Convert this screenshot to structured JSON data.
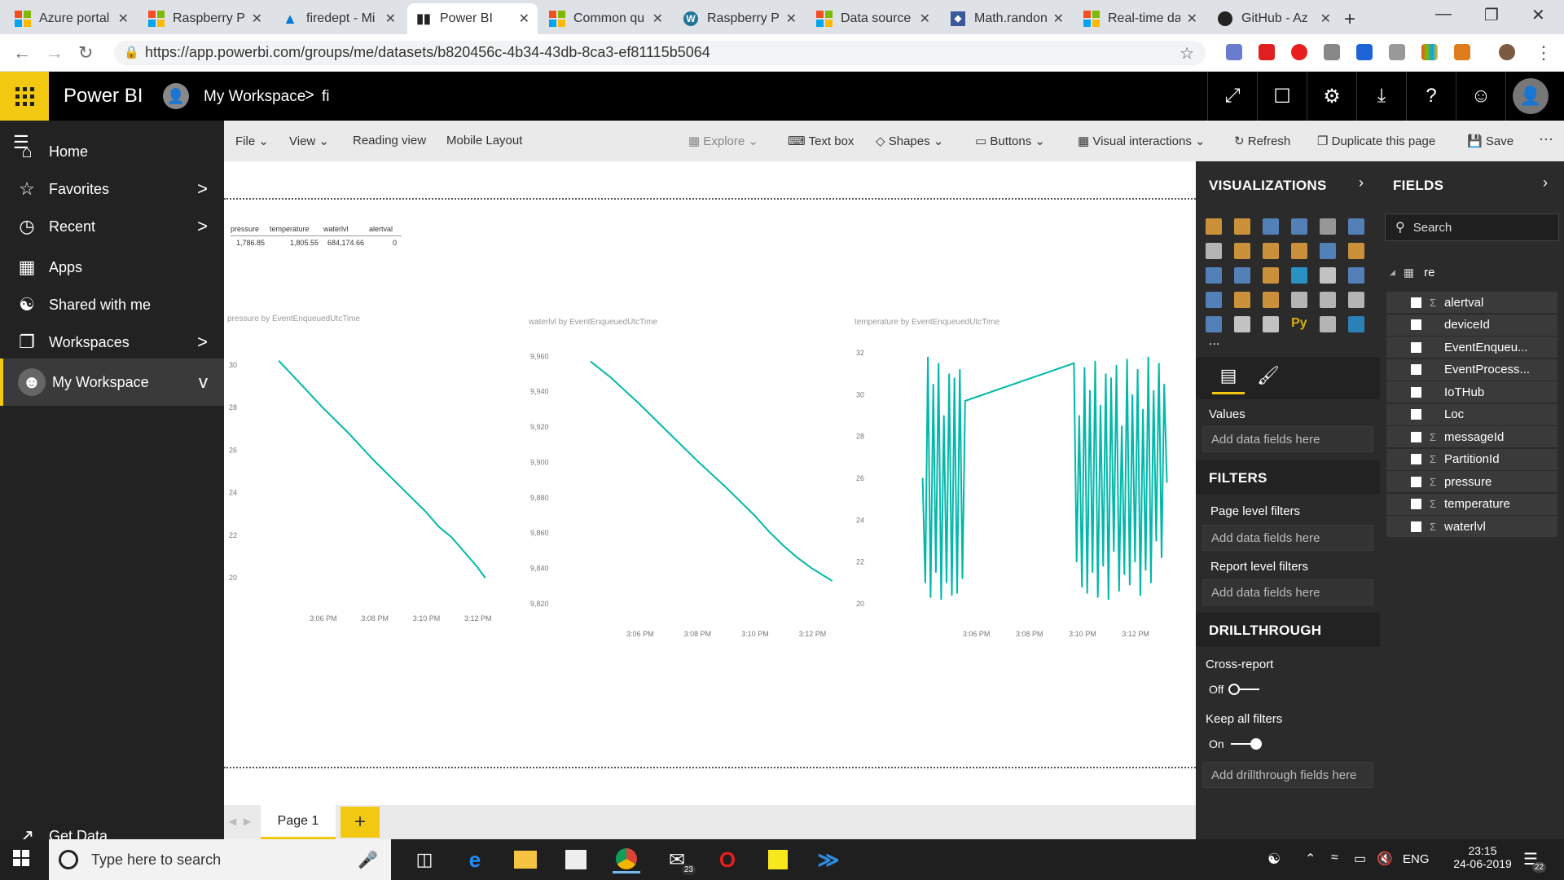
{
  "browser": {
    "tabs": [
      {
        "label": "Azure portal",
        "icon": "microsoft-icon"
      },
      {
        "label": "Raspberry Pi",
        "icon": "microsoft-icon"
      },
      {
        "label": "firedept - Mi",
        "icon": "azure-icon"
      },
      {
        "label": "Power BI",
        "icon": "powerbi-icon",
        "active": true
      },
      {
        "label": "Common qu",
        "icon": "microsoft-icon"
      },
      {
        "label": "Raspberry Pi",
        "icon": "wordpress-icon"
      },
      {
        "label": "Data source",
        "icon": "microsoft-icon"
      },
      {
        "label": "Math.randon",
        "icon": "js-icon"
      },
      {
        "label": "Real-time da",
        "icon": "microsoft-icon"
      },
      {
        "label": "GitHub - Az",
        "icon": "github-icon"
      }
    ],
    "url": "https://app.powerbi.com/groups/me/datasets/b820456c-4b34-43db-8ca3-ef81115b5064"
  },
  "header": {
    "app_name": "Power BI",
    "workspace": "My Workspace",
    "separator": ">",
    "report": "fi"
  },
  "leftnav": {
    "items": [
      {
        "label": "Home",
        "icon": "home-icon",
        "chevron": ""
      },
      {
        "label": "Favorites",
        "icon": "star-icon",
        "chevron": ">"
      },
      {
        "label": "Recent",
        "icon": "clock-icon",
        "chevron": ">"
      },
      {
        "label": "Apps",
        "icon": "apps-icon",
        "chevron": ""
      },
      {
        "label": "Shared with me",
        "icon": "shared-icon",
        "chevron": ""
      },
      {
        "label": "Workspaces",
        "icon": "workspaces-icon",
        "chevron": ">"
      },
      {
        "label": "My Workspace",
        "icon": "user-icon",
        "chevron": "v"
      }
    ],
    "get_data": "Get Data"
  },
  "toolbar": {
    "file": "File",
    "view": "View",
    "reading_view": "Reading view",
    "mobile_layout": "Mobile Layout",
    "explore": "Explore",
    "text_box": "Text box",
    "shapes": "Shapes",
    "buttons": "Buttons",
    "visual_interactions": "Visual interactions",
    "refresh": "Refresh",
    "duplicate": "Duplicate this page",
    "save": "Save",
    "more": "···"
  },
  "table_visual": {
    "headers": [
      "pressure",
      "temperature",
      "waterlvl",
      "alertval"
    ],
    "values": [
      "1,786.85",
      "1,805.55",
      "684,174.66",
      "0"
    ]
  },
  "charts_text": {
    "c1_title": "pressure by EventEnqueuedUtcTime",
    "c2_title": "waterlvl by EventEnqueuedUtcTime",
    "c3_title": "temperature by EventEnqueuedUtcTime"
  },
  "chart_data": [
    {
      "type": "line",
      "title": "pressure by EventEnqueuedUtcTime",
      "x_ticks": [
        "3:06 PM",
        "3:08 PM",
        "3:10 PM",
        "3:12 PM"
      ],
      "y_ticks": [
        20,
        22,
        24,
        26,
        28,
        30
      ],
      "ylim": [
        19.5,
        30.5
      ],
      "x_minutes": [
        4.3,
        5.0,
        6.0,
        7.0,
        8.0,
        9.0,
        10.0,
        10.5,
        11.0,
        11.5,
        12.0,
        12.3
      ],
      "values": [
        30.2,
        29.3,
        28.0,
        26.8,
        25.5,
        24.3,
        23.1,
        22.4,
        21.9,
        21.2,
        20.5,
        20.0
      ],
      "color": "#01b8aa"
    },
    {
      "type": "line",
      "title": "waterlvl by EventEnqueuedUtcTime",
      "x_ticks": [
        "3:06 PM",
        "3:08 PM",
        "3:10 PM",
        "3:12 PM"
      ],
      "y_ticks": [
        9820,
        9840,
        9860,
        9880,
        9900,
        9920,
        9940,
        9960
      ],
      "ylim": [
        9820,
        9962
      ],
      "x_minutes": [
        4.3,
        5.0,
        6.0,
        7.0,
        8.0,
        9.0,
        10.0,
        10.5,
        11.0,
        11.5,
        12.0,
        12.7
      ],
      "values": [
        9957,
        9948,
        9933,
        9917,
        9901,
        9886,
        9870,
        9861,
        9853,
        9846,
        9840,
        9833
      ],
      "color": "#01b8aa"
    },
    {
      "type": "line",
      "title": "temperature by EventEnqueuedUtcTime",
      "x_ticks": [
        "3:06 PM",
        "3:08 PM",
        "3:10 PM",
        "3:12 PM"
      ],
      "y_ticks": [
        20,
        22,
        24,
        26,
        28,
        30,
        32
      ],
      "ylim": [
        20,
        32
      ],
      "x_minutes": [
        4.0,
        4.1,
        4.2,
        4.3,
        4.4,
        4.5,
        4.6,
        4.7,
        4.8,
        4.9,
        5.0,
        5.1,
        5.2,
        5.3,
        5.4,
        5.5,
        5.6,
        9.7,
        9.8,
        9.9,
        10.0,
        10.1,
        10.2,
        10.3,
        10.4,
        10.5,
        10.6,
        10.7,
        10.8,
        10.9,
        11.0,
        11.1,
        11.2,
        11.3,
        11.4,
        11.5,
        11.6,
        11.7,
        11.8,
        11.9,
        12.0,
        12.1,
        12.2,
        12.3,
        12.4,
        12.5,
        12.6,
        12.7,
        12.8,
        12.9,
        13.0,
        13.1,
        13.2
      ],
      "values": [
        26,
        21,
        31.8,
        20.3,
        30.5,
        21.5,
        31.5,
        20.2,
        29,
        21,
        31,
        20.4,
        30.8,
        20.5,
        31.2,
        21.2,
        29.7,
        31.5,
        22,
        29,
        20.8,
        31.3,
        20.5,
        30.2,
        21.5,
        31.6,
        20.3,
        29.5,
        21.8,
        31,
        20.2,
        30.8,
        22.5,
        31.4,
        20.6,
        28.5,
        21.4,
        31.7,
        20.9,
        30,
        22,
        31.2,
        20.4,
        29.3,
        21.6,
        31.8,
        21,
        30.2,
        23,
        31.5,
        22.2,
        30.5,
        25.8
      ],
      "color": "#01b8aa"
    }
  ],
  "pagebar": {
    "page": "Page 1",
    "add": "+"
  },
  "viz_pane": {
    "title": "VISUALIZATIONS",
    "more": "...",
    "values": "Values",
    "add_fields": "Add data fields here",
    "filters": "FILTERS",
    "page_filters": "Page level filters",
    "report_filters": "Report level filters",
    "drillthrough": "DRILLTHROUGH",
    "cross_report": "Cross-report",
    "off": "Off",
    "keep_filters": "Keep all filters",
    "on": "On",
    "add_drill": "Add drillthrough fields here"
  },
  "fields_pane": {
    "title": "FIELDS",
    "search_placeholder": "Search",
    "table": "re",
    "fields": [
      {
        "name": "alertval",
        "sigma": true
      },
      {
        "name": "deviceId",
        "sigma": false
      },
      {
        "name": "EventEnqueu...",
        "sigma": false
      },
      {
        "name": "EventProcess...",
        "sigma": false
      },
      {
        "name": "IoTHub",
        "sigma": false
      },
      {
        "name": "Loc",
        "sigma": false
      },
      {
        "name": "messageId",
        "sigma": true
      },
      {
        "name": "PartitionId",
        "sigma": true
      },
      {
        "name": "pressure",
        "sigma": true
      },
      {
        "name": "temperature",
        "sigma": true
      },
      {
        "name": "waterlvl",
        "sigma": true
      }
    ]
  },
  "taskbar": {
    "search_placeholder": "Type here to search",
    "mail_badge": "23",
    "language": "ENG",
    "time": "23:15",
    "date": "24-06-2019",
    "notif_badge": "22"
  }
}
